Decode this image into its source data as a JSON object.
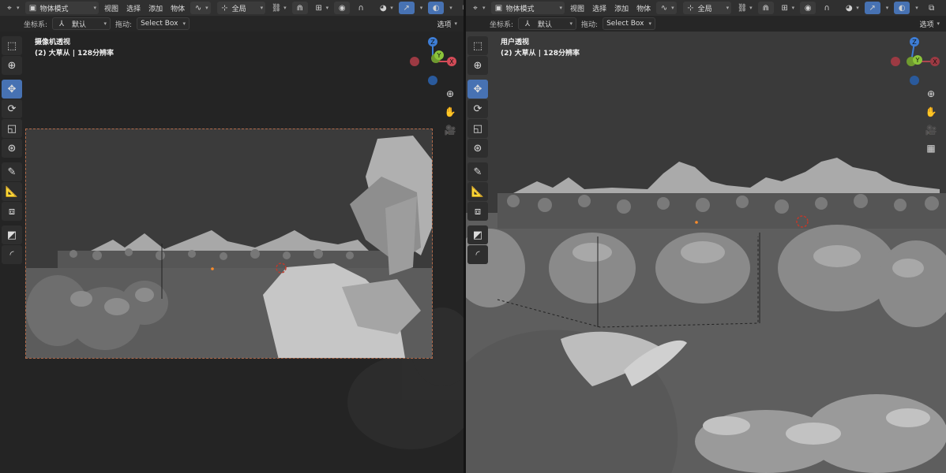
{
  "left": {
    "header": {
      "editor_icon": "3d-viewport-icon",
      "mode_label": "物体模式",
      "menus": [
        "视图",
        "选择",
        "添加",
        "物体"
      ],
      "transform_orientation": "全局"
    },
    "subheader": {
      "coord_label": "坐标系:",
      "coord_value": "默认",
      "drag_label": "拖动:",
      "drag_value": "Select Box",
      "options_label": "选项"
    },
    "overlay": {
      "view_name": "摄像机透视",
      "info": "(2) 大草从 | 128分辨率"
    },
    "gizmo_labels": {
      "x": "X",
      "y": "Y",
      "z": "Z"
    }
  },
  "right": {
    "header": {
      "editor_icon": "3d-viewport-icon",
      "mode_label": "物体模式",
      "menus": [
        "视图",
        "选择",
        "添加",
        "物体"
      ],
      "transform_orientation": "全局"
    },
    "subheader": {
      "coord_label": "坐标系:",
      "coord_value": "默认",
      "drag_label": "拖动:",
      "drag_value": "Select Box",
      "options_label": "选项"
    },
    "overlay": {
      "view_name": "用户透视",
      "info": "(2) 大草从 | 128分辨率"
    },
    "gizmo_labels": {
      "x": "X",
      "y": "Y",
      "z": "Z"
    }
  },
  "tools": [
    "select-box-tool",
    "cursor-tool",
    "move-tool",
    "rotate-tool",
    "scale-tool",
    "transform-tool",
    "annotate-tool",
    "measure-tool",
    "add-cube-tool",
    "shade-tool",
    "bevel-tool"
  ],
  "colors": {
    "accent": "#4772b3",
    "axis_x": "#d34b57",
    "axis_y": "#8bc43a",
    "axis_z": "#3d7dd6",
    "camera_border": "#b26a4a"
  }
}
